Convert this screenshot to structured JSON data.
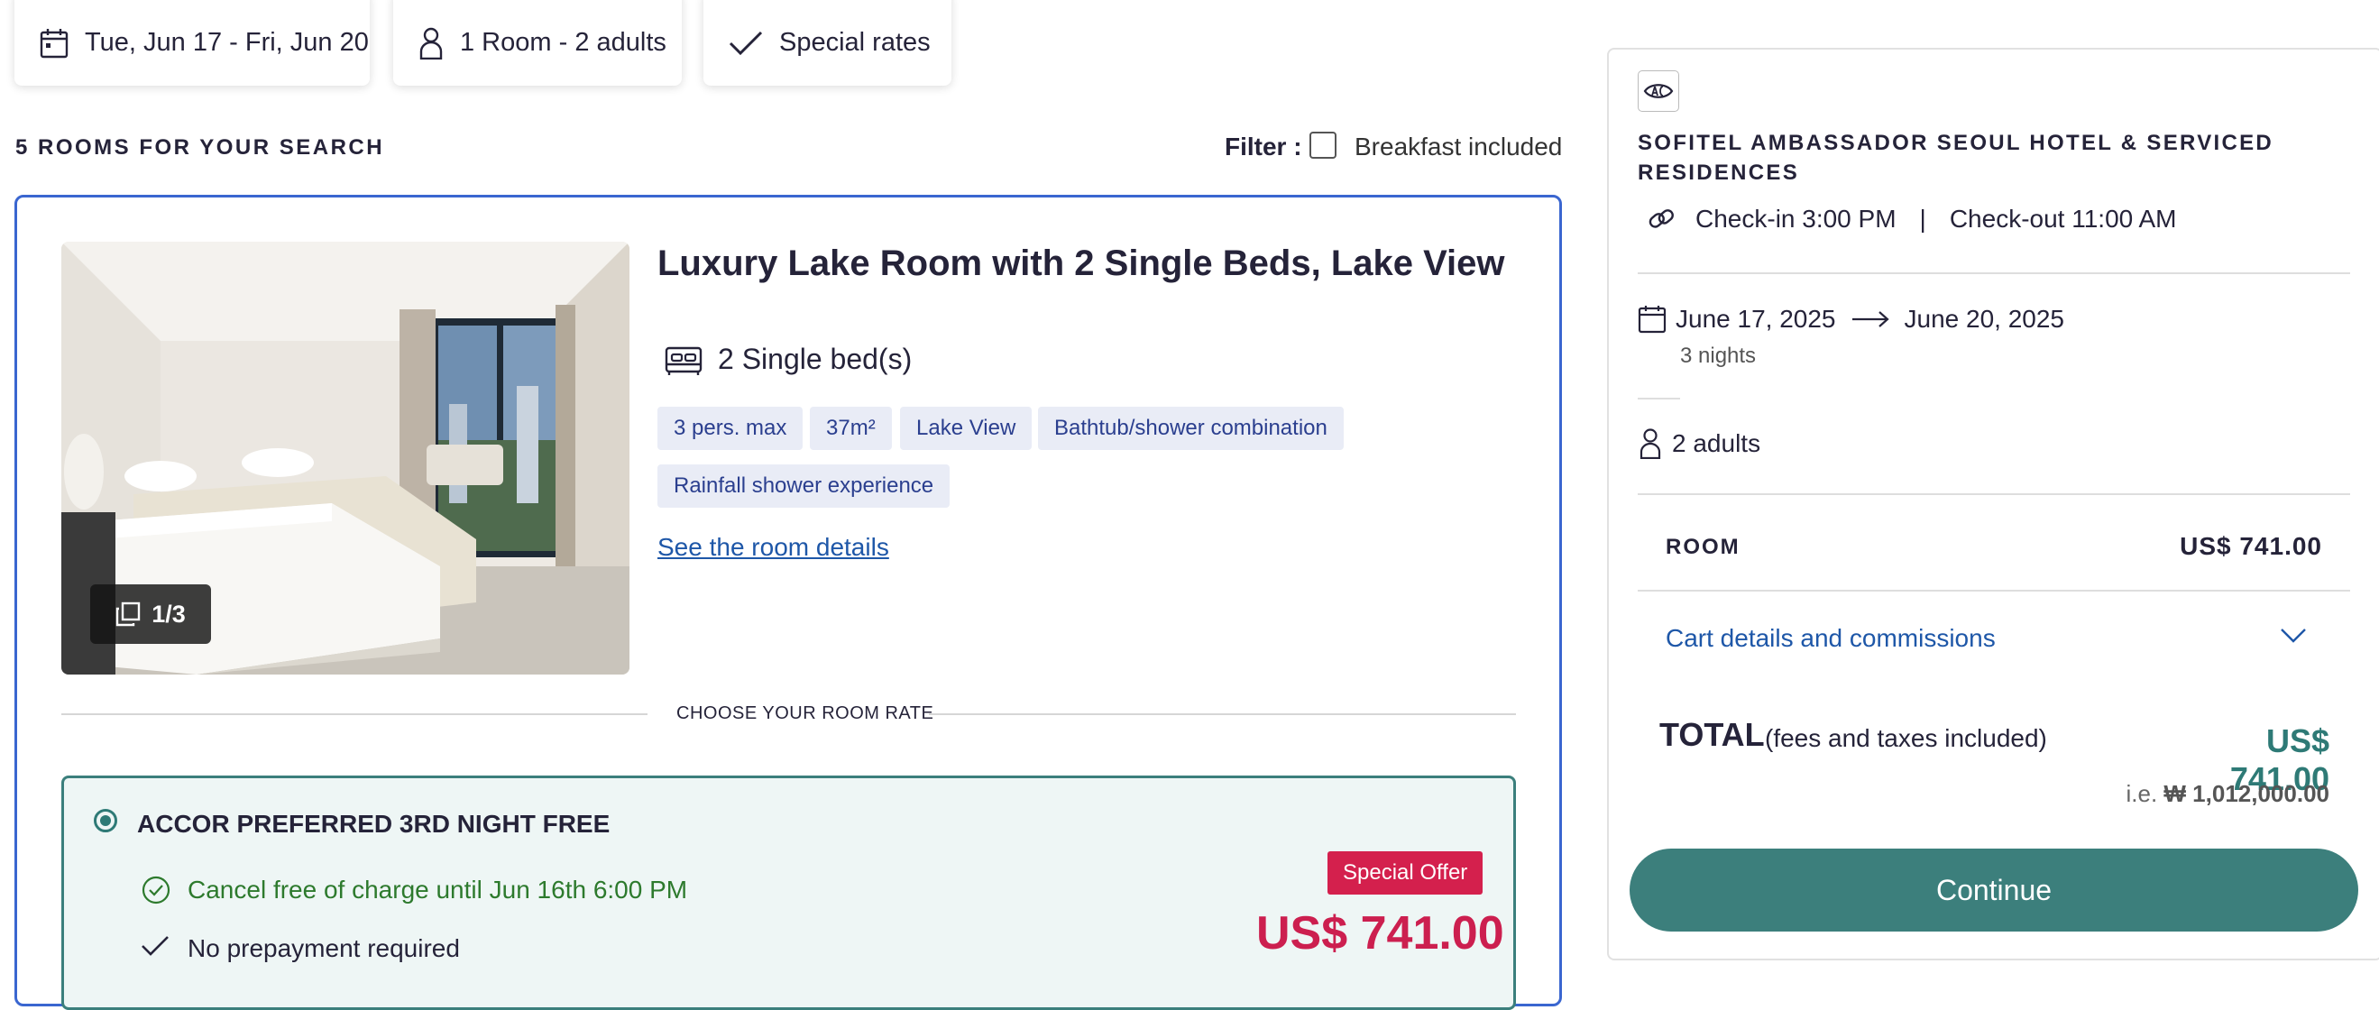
{
  "search_bar": {
    "dates": "Tue, Jun 17 - Fri, Jun 20",
    "guests": "1 Room - 2 adults",
    "rates": "Special rates"
  },
  "results": {
    "count_text": "5 ROOMS FOR YOUR SEARCH",
    "filter_label": "Filter :",
    "filter_option": "Breakfast included",
    "filter_checked": false
  },
  "room": {
    "title": "Luxury Lake Room with 2 Single Beds, Lake View",
    "photo_counter": "1/3",
    "beds": "2 Single bed(s)",
    "tags": [
      "3 pers. max",
      "37m²",
      "Lake View",
      "Bathtub/shower combination",
      "Rainfall shower experience"
    ],
    "details_link": "See the room details",
    "choose_rate_label": "CHOOSE YOUR ROOM RATE"
  },
  "rate": {
    "name": "ACCOR PREFERRED 3RD NIGHT FREE",
    "cancel_policy": "Cancel free of charge until Jun 16th 6:00 PM",
    "prepayment": "No prepayment required",
    "badge": "Special Offer",
    "price": "US$ 741.00",
    "selected": true
  },
  "summary": {
    "hotel_name": "SOFITEL AMBASSADOR SEOUL HOTEL & SERVICED RESIDENCES",
    "check_in": "Check-in 3:00 PM",
    "divider": "|",
    "check_out": "Check-out 11:00 AM",
    "date_from": "June 17, 2025",
    "date_to": "June 20, 2025",
    "nights": "3 nights",
    "guests": "2 adults",
    "room_label": "ROOM",
    "room_price": "US$ 741.00",
    "cart_link": "Cart details and commissions",
    "total_label": "TOTAL",
    "total_sub": "(fees and taxes included)",
    "total_price": "US$ 741.00",
    "ie_prefix": "i.e.",
    "total_local": "₩ 1,012,000.00",
    "continue_label": "Continue"
  },
  "colors": {
    "accent_teal": "#3c7f7c",
    "price_red": "#cc1f4f",
    "link_blue": "#1e57a8",
    "card_border_blue": "#3a66d0",
    "tag_bg": "#e9ecf6"
  },
  "icons": [
    "calendar-icon",
    "person-icon",
    "checkmark-icon",
    "bed-icon",
    "gallery-icon",
    "clock-check-icon",
    "hotel-brand-icon",
    "link-icon",
    "arrow-right-icon",
    "chevron-down-icon"
  ]
}
